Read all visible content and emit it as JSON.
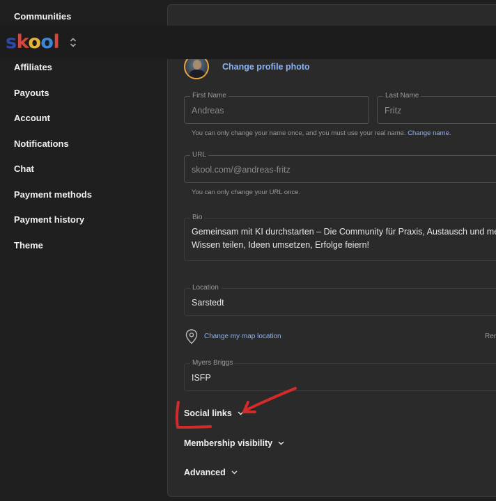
{
  "topbar": {
    "logo": {
      "s": "s",
      "k": "k",
      "o1": "o",
      "o2": "o",
      "l": "l"
    },
    "switcher_icon": "chevron-up-down-icon"
  },
  "sidebar": {
    "items": [
      {
        "label": "Communities"
      },
      {
        "label": "Affiliates"
      },
      {
        "label": "Payouts"
      },
      {
        "label": "Account"
      },
      {
        "label": "Notifications"
      },
      {
        "label": "Chat"
      },
      {
        "label": "Payment methods"
      },
      {
        "label": "Payment history"
      },
      {
        "label": "Theme"
      }
    ]
  },
  "profile": {
    "change_photo_label": "Change profile photo",
    "first_name": {
      "label": "First Name",
      "value": "Andreas"
    },
    "last_name": {
      "label": "Last Name",
      "value": "Fritz"
    },
    "name_helper": "You can only change your name once, and you must use your real name.",
    "change_name_link": "Change name.",
    "url": {
      "label": "URL",
      "value": "skool.com/@andreas-fritz"
    },
    "url_helper": "You can only change your URL once.",
    "bio": {
      "label": "Bio",
      "line1": "Gemeinsam mit KI durchstarten – Die Community für Praxis, Austausch und mess",
      "line2": "Wissen teilen, Ideen umsetzen, Erfolge feiern!"
    },
    "location": {
      "label": "Location",
      "value": "Sarstedt"
    },
    "map_link": "Change my map location",
    "remove_partial": "Rem",
    "myers_briggs": {
      "label": "Myers Briggs",
      "value": "ISFP"
    },
    "sections": {
      "social_links": "Social links",
      "membership_visibility": "Membership visibility",
      "advanced": "Advanced"
    }
  },
  "annotation": {
    "color": "#d42a2a"
  },
  "colors": {
    "accent_link": "#8ab4f8",
    "background": "#1f1f1f",
    "panel": "#2a2a2a"
  }
}
